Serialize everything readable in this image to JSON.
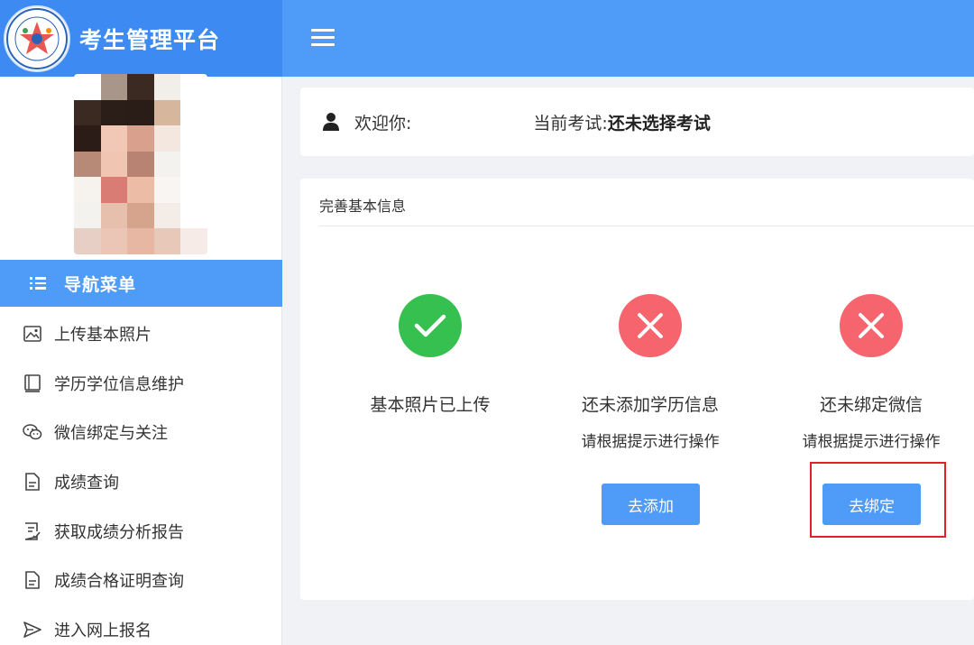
{
  "header": {
    "brand_title": "考生管理平台"
  },
  "sidebar": {
    "nav_title": "导航菜单",
    "items": [
      {
        "label": "上传基本照片",
        "icon": "image-icon"
      },
      {
        "label": "学历学位信息维护",
        "icon": "book-icon"
      },
      {
        "label": "微信绑定与关注",
        "icon": "wechat-icon"
      },
      {
        "label": "成绩查询",
        "icon": "document-icon"
      },
      {
        "label": "获取成绩分析报告",
        "icon": "report-icon"
      },
      {
        "label": "成绩合格证明查询",
        "icon": "document-icon"
      },
      {
        "label": "进入网上报名",
        "icon": "send-icon"
      }
    ]
  },
  "welcome": {
    "greeting_label": "欢迎你:",
    "exam_label": "当前考试:",
    "exam_value": "还未选择考试"
  },
  "info": {
    "title": "完善基本信息",
    "items": [
      {
        "status": "ok",
        "text": "基本照片已上传",
        "hint": "",
        "button": ""
      },
      {
        "status": "missing",
        "text": "还未添加学历信息",
        "hint": "请根据提示进行操作",
        "button": "去添加"
      },
      {
        "status": "missing",
        "text": "还未绑定微信",
        "hint": "请根据提示进行操作",
        "button": "去绑定"
      }
    ]
  },
  "colors": {
    "primary": "#4f9bf8",
    "brand_bg": "#3d8af2",
    "success": "#36c04f",
    "danger": "#f6656d",
    "highlight": "#e0202a"
  }
}
